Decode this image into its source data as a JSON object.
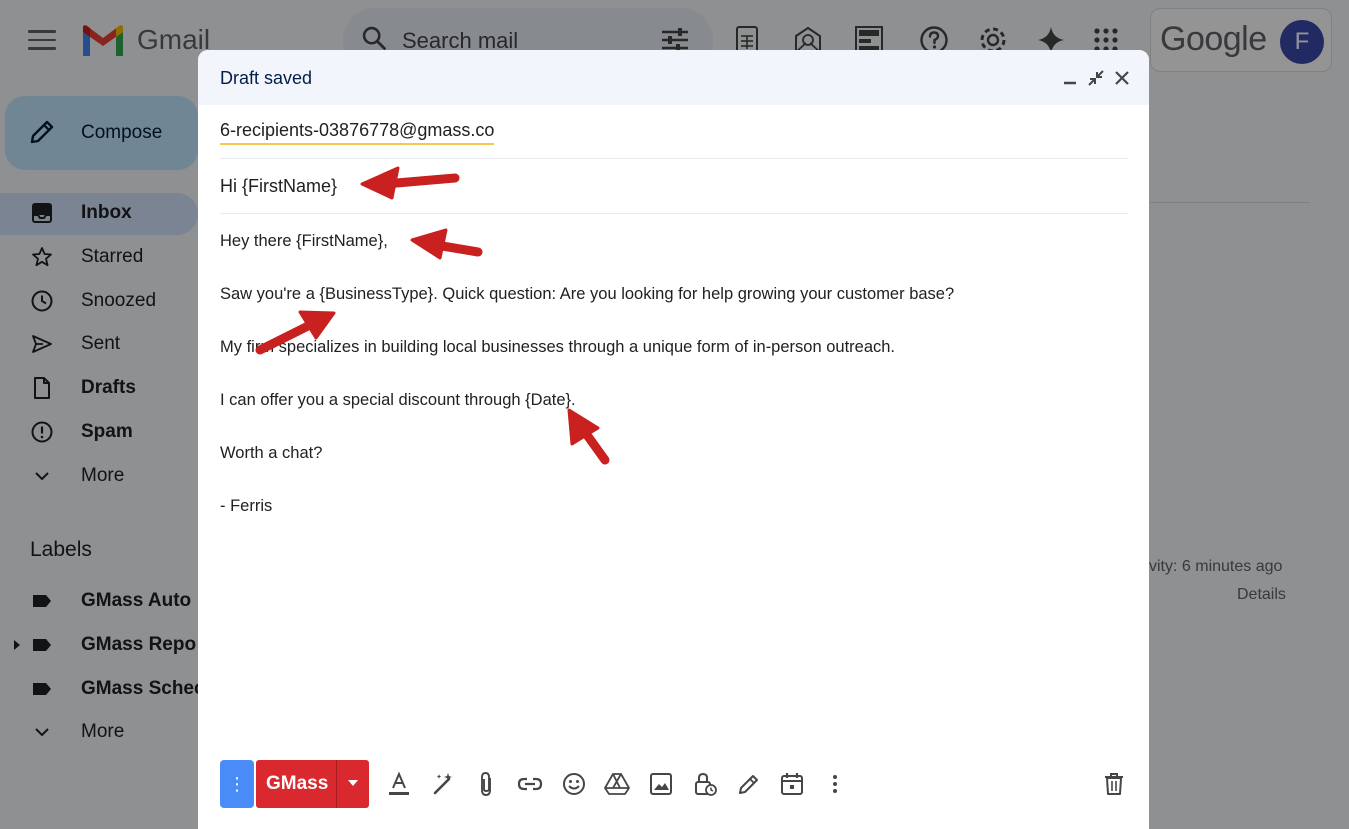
{
  "app": {
    "brand": "Gmail",
    "search_placeholder": "Search mail",
    "google_label": "Google",
    "avatar_initial": "F"
  },
  "sidebar": {
    "compose_label": "Compose",
    "items": [
      {
        "label": "Inbox",
        "bold": true,
        "active": true
      },
      {
        "label": "Starred"
      },
      {
        "label": "Snoozed"
      },
      {
        "label": "Sent"
      },
      {
        "label": "Drafts",
        "bold": true
      },
      {
        "label": "Spam",
        "bold": true
      },
      {
        "label": "More"
      }
    ],
    "labels_title": "Labels",
    "labels": [
      {
        "label": "GMass Auto"
      },
      {
        "label": "GMass Repo"
      },
      {
        "label": "GMass Schec"
      },
      {
        "label": "More"
      }
    ]
  },
  "background": {
    "activity": "vity: 6 minutes ago",
    "details": "Details"
  },
  "compose": {
    "title": "Draft saved",
    "to": "6-recipients-03876778@gmass.co",
    "subject": "Hi {FirstName}",
    "body": [
      "Hey there {FirstName},",
      "Saw you're a {BusinessType}. Quick question: Are you looking for help growing your customer base?",
      "My firm specializes in building local businesses through a unique form of in-person outreach.",
      "I can offer you a special discount through {Date}.",
      "Worth a chat?",
      "- Ferris"
    ],
    "toolbar": {
      "gmass_label": "GMass",
      "more_options_glyph": "⋮"
    }
  },
  "colors": {
    "annotation_arrow": "#c8211f",
    "gmass_red": "#d9292f",
    "compose_blue": "#c2e7ff"
  }
}
